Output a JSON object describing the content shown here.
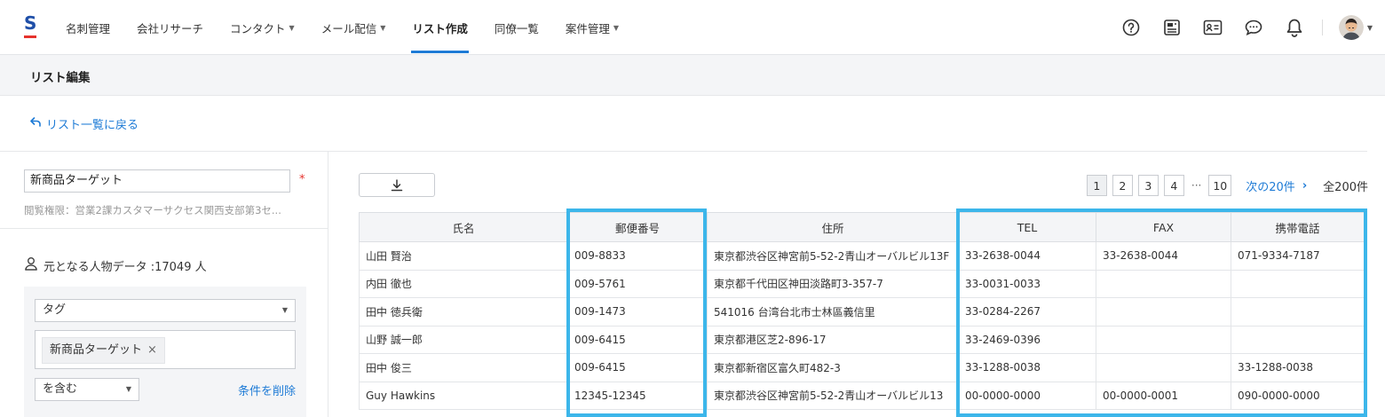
{
  "header": {
    "logo_letter": "S",
    "nav": [
      {
        "label": "名刺管理",
        "caret": false,
        "active": false
      },
      {
        "label": "会社リサーチ",
        "caret": false,
        "active": false
      },
      {
        "label": "コンタクト",
        "caret": true,
        "active": false
      },
      {
        "label": "メール配信",
        "caret": true,
        "active": false
      },
      {
        "label": "リスト作成",
        "caret": false,
        "active": true
      },
      {
        "label": "同僚一覧",
        "caret": false,
        "active": false
      },
      {
        "label": "案件管理",
        "caret": true,
        "active": false
      }
    ],
    "icons": [
      "help-icon",
      "news-icon",
      "contact-card-icon",
      "chat-icon",
      "bell-icon"
    ]
  },
  "subheader": {
    "title": "リスト編集"
  },
  "back_link": "リスト一覧に戻る",
  "left": {
    "list_name": "新商品ターゲット",
    "required_mark": "*",
    "permission": "閲覧権限：営業2課カスタマーサクセス関西支部第3セ...",
    "source_label": "元となる人物データ :17049 人",
    "filter": {
      "field": "タグ",
      "tag": "新商品ターゲット",
      "tag_remove": "×",
      "condition": "を含む",
      "delete_label": "条件を削除"
    }
  },
  "pagination": {
    "pages": [
      "1",
      "2",
      "3",
      "4"
    ],
    "ellipsis": "···",
    "last": "10",
    "next": "次の20件",
    "next_chevron": "›",
    "total": "全200件",
    "current": "1"
  },
  "table": {
    "columns": [
      "氏名",
      "郵便番号",
      "住所",
      "TEL",
      "FAX",
      "携帯電話"
    ],
    "rows": [
      [
        "山田 賢治",
        "009-8833",
        "東京都渋谷区神宮前5-52-2青山オーバルビル13F",
        "33-2638-0044",
        "33-2638-0044",
        "071-9334-7187"
      ],
      [
        "内田 徹也",
        "009-5761",
        "東京都千代田区神田淡路町3-357-7",
        "33-0031-0033",
        "",
        ""
      ],
      [
        "田中 徳兵衛",
        "009-1473",
        "541016 台湾台北市士林區義信里",
        "33-0284-2267",
        "",
        ""
      ],
      [
        "山野 誠一郎",
        "009-6415",
        "東京都港区芝2-896-17",
        "33-2469-0396",
        "",
        ""
      ],
      [
        "田中 俊三",
        "009-6415",
        "東京都新宿区富久町482-3",
        "33-1288-0038",
        "",
        "33-1288-0038"
      ],
      [
        "Guy Hawkins",
        "12345-12345",
        "東京都渋谷区神宮前5-52-2青山オーバルビル13",
        "00-0000-0000",
        "00-0000-0001",
        "090-0000-0000"
      ]
    ]
  },
  "colors": {
    "accent": "#1e7bd6",
    "highlight": "#3cb6ea",
    "required": "#e5322d"
  }
}
